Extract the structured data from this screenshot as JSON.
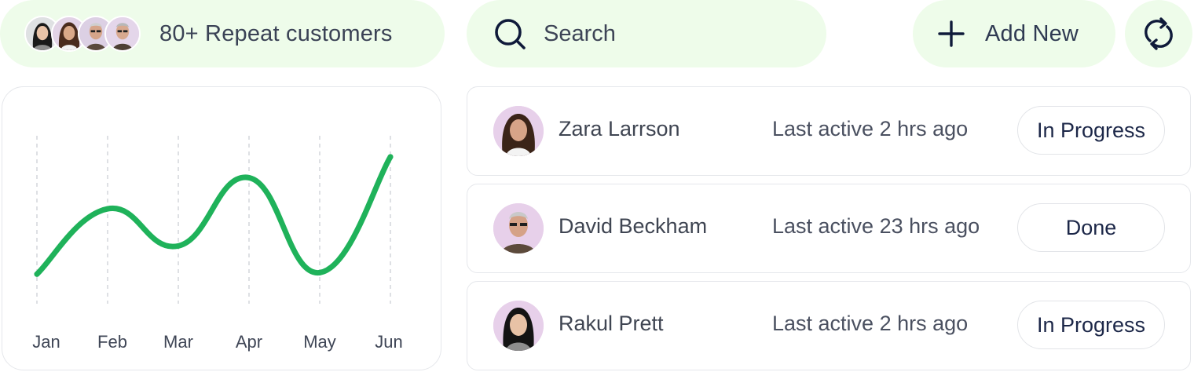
{
  "header": {
    "repeat_customers_label": "80+ Repeat customers",
    "search_placeholder": "Search",
    "add_new_label": "Add New",
    "refresh_icon": "refresh-icon"
  },
  "chart_data": {
    "type": "line",
    "categories": [
      "Jan",
      "Feb",
      "Mar",
      "Apr",
      "May",
      "Jun"
    ],
    "series": [
      {
        "values": [
          21,
          65,
          40,
          86,
          22,
          100
        ]
      }
    ],
    "ylim": [
      0,
      110
    ],
    "grid": "dashed-vertical",
    "color": "#1fb25a",
    "title": "",
    "xlabel": "",
    "ylabel": ""
  },
  "customers": [
    {
      "name": "Zara Larrson",
      "active": "Last active 2 hrs ago",
      "status": "In Progress"
    },
    {
      "name": "David Beckham",
      "active": "Last active 23 hrs ago",
      "status": "Done"
    },
    {
      "name": "Rakul Prett",
      "active": "Last active 2 hrs ago",
      "status": "In Progress"
    }
  ],
  "colors": {
    "pill_bg": "#eefcea",
    "line": "#1fb25a",
    "avatar_bg": "#e7d0ea",
    "text": "#1c2748"
  }
}
